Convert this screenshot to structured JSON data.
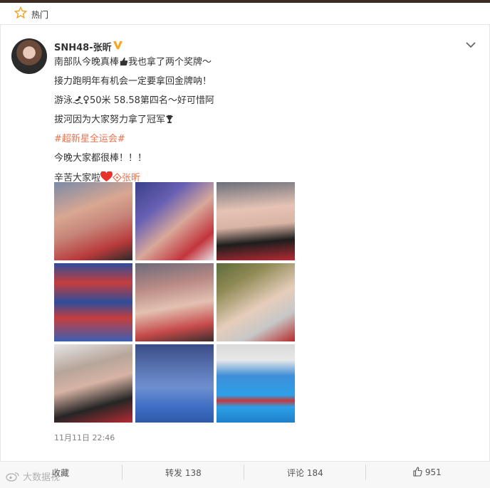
{
  "hot_bar": {
    "label": "热门",
    "icon": "star-outline-icon"
  },
  "post": {
    "username": "SNH48-张昕",
    "verified_icon": "vip-v-icon",
    "lines": [
      "南部队今晚真棒",
      "我也拿了两个奖牌～",
      "接力跑明年有机会一定要拿回金牌呐！",
      "游泳",
      "50米 58.58第四名～好可惜阿",
      "拔河因为大家努力拿了冠军",
      "#超新星全运会#",
      "今晚大家都很棒！！！",
      "辛苦大家啦",
      "张昕"
    ],
    "timestamp": "11月11日 22:46"
  },
  "actions": {
    "collect_label": "收藏",
    "repost_label": "转发 138",
    "comment_label": "评论 184",
    "like_label": "951"
  },
  "watermark": "大数据视",
  "colors": {
    "link": "#eb7350",
    "text": "#333333",
    "meta": "#808080",
    "action_bg": "#f7f7f7"
  }
}
